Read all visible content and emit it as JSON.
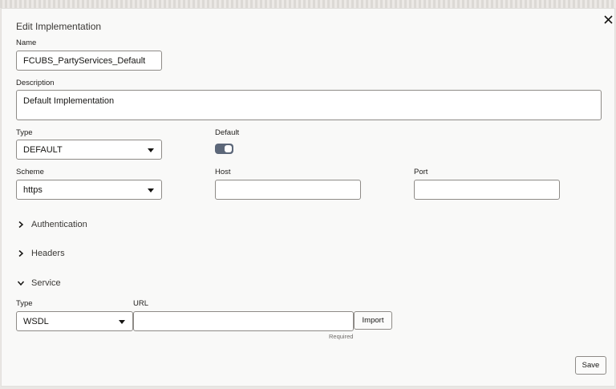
{
  "dialog": {
    "title": "Edit Implementation",
    "close_icon": "close-icon"
  },
  "name": {
    "label": "Name",
    "value": "FCUBS_PartyServices_Default"
  },
  "description": {
    "label": "Description",
    "value": "Default Implementation"
  },
  "type": {
    "label": "Type",
    "value": "DEFAULT",
    "icon": "chevron-down-icon"
  },
  "default": {
    "label": "Default",
    "enabled": true
  },
  "scheme": {
    "label": "Scheme",
    "value": "https",
    "icon": "chevron-down-icon"
  },
  "host": {
    "label": "Host",
    "value": ""
  },
  "port": {
    "label": "Port",
    "value": ""
  },
  "sections": {
    "authentication": {
      "label": "Authentication",
      "expanded": false
    },
    "headers": {
      "label": "Headers",
      "expanded": false
    },
    "service": {
      "label": "Service",
      "expanded": true
    }
  },
  "service": {
    "type_label": "Type",
    "type_value": "WSDL",
    "url_label": "URL",
    "url_value": "",
    "url_hint": "Required",
    "import_label": "Import"
  },
  "footer": {
    "save_label": "Save"
  },
  "colors": {
    "toggle_on": "#5c6779",
    "background": "#f9f9f8",
    "border": "#8e8b87"
  }
}
